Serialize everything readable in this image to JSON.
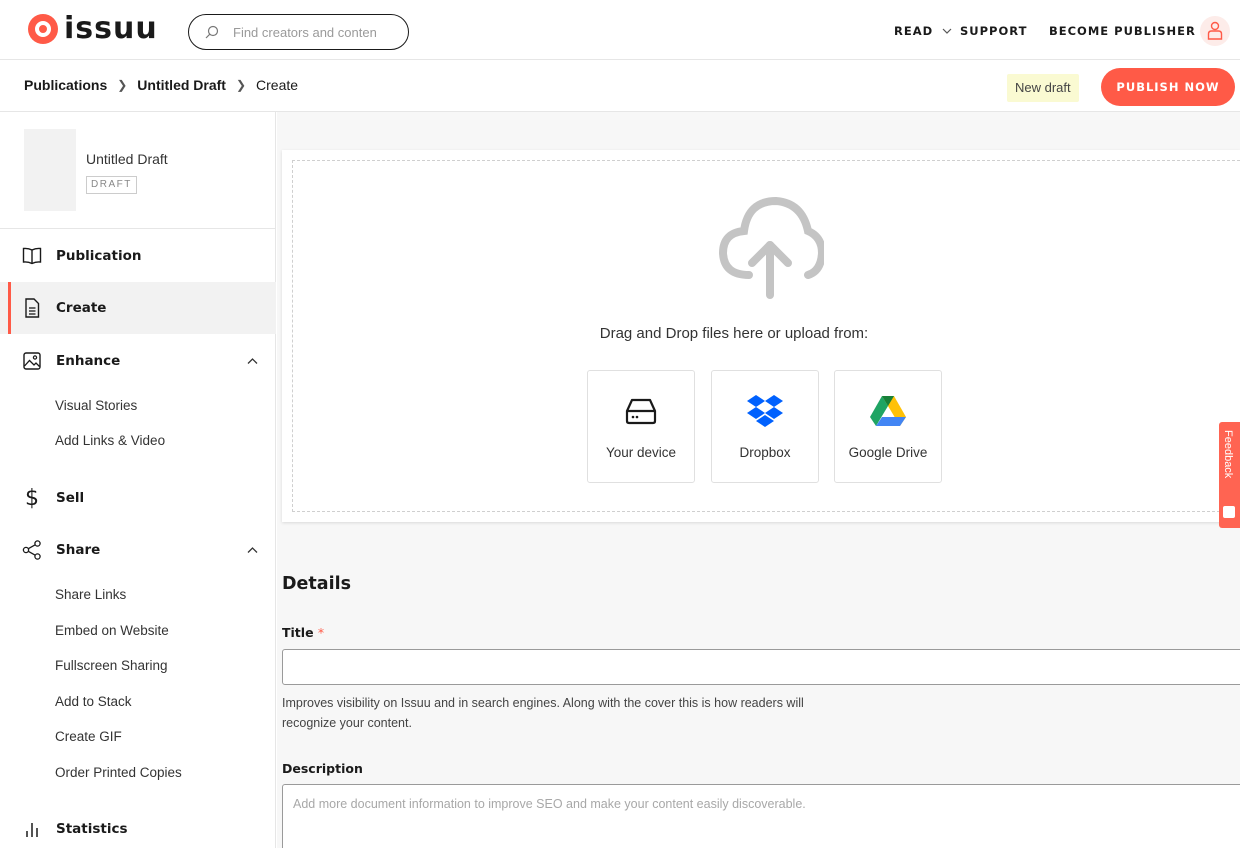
{
  "brand": {
    "logo_text": "issuu",
    "accent": "#ff5a47"
  },
  "header": {
    "search_placeholder": "Find creators and conten",
    "nav": {
      "read": "READ",
      "support": "SUPPORT",
      "become_publisher": "BECOME PUBLISHER"
    }
  },
  "breadcrumb": {
    "items": [
      "Publications",
      "Untitled Draft",
      "Create"
    ]
  },
  "status": {
    "new_draft": "New draft",
    "publish_label": "PUBLISH NOW"
  },
  "sidebar": {
    "draft_title": "Untitled Draft",
    "draft_badge": "DRAFT",
    "items": [
      {
        "label": "Publication",
        "icon": "book-open-icon"
      },
      {
        "label": "Create",
        "icon": "document-icon",
        "active": true
      },
      {
        "label": "Enhance",
        "icon": "image-icon",
        "expanded": true
      },
      {
        "label": "Sell",
        "icon": "dollar-icon"
      },
      {
        "label": "Share",
        "icon": "share-icon",
        "expanded": true
      },
      {
        "label": "Statistics",
        "icon": "bar-chart-icon"
      }
    ],
    "enhance_sub": [
      "Visual Stories",
      "Add Links & Video"
    ],
    "share_sub": [
      "Share Links",
      "Embed on Website",
      "Fullscreen Sharing",
      "Add to Stack",
      "Create GIF",
      "Order Printed Copies"
    ]
  },
  "upload": {
    "drop_text": "Drag and Drop files here or upload from:",
    "sources": [
      {
        "label": "Your device",
        "icon": "hard-drive-icon"
      },
      {
        "label": "Dropbox",
        "icon": "dropbox-icon"
      },
      {
        "label": "Google Drive",
        "icon": "google-drive-icon"
      }
    ]
  },
  "details": {
    "heading": "Details",
    "title_label": "Title",
    "required_mark": "*",
    "title_value": "",
    "title_help": "Improves visibility on Issuu and in search engines. Along with the cover this is how readers will recognize your content.",
    "description_label": "Description",
    "description_placeholder": "Add more document information to improve SEO and make your content easily discoverable."
  },
  "feedback_label": "Feedback"
}
